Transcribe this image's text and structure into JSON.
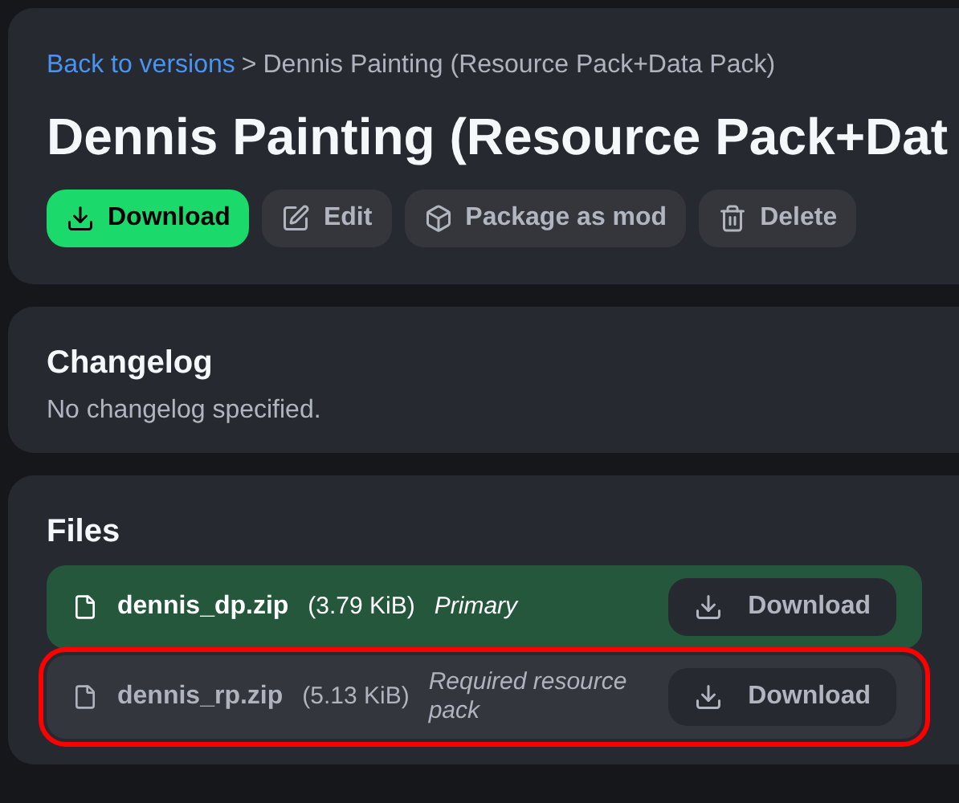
{
  "breadcrumb": {
    "link": "Back to versions",
    "separator": ">",
    "current": "Dennis Painting (Resource Pack+Data Pack)"
  },
  "title": "Dennis Painting (Resource Pack+Dat",
  "actions": [
    {
      "label": "Download",
      "kind": "download",
      "primary": true
    },
    {
      "label": "Edit",
      "kind": "edit",
      "primary": false
    },
    {
      "label": "Package as mod",
      "kind": "package",
      "primary": false
    },
    {
      "label": "Delete",
      "kind": "delete",
      "primary": false
    }
  ],
  "changelog": {
    "heading": "Changelog",
    "text": "No changelog specified."
  },
  "files": {
    "heading": "Files",
    "items": [
      {
        "name": "dennis_dp.zip",
        "size": "(3.79 KiB)",
        "tag": "Primary",
        "primary": true,
        "highlighted": false,
        "button": "Download"
      },
      {
        "name": "dennis_rp.zip",
        "size": "(5.13 KiB)",
        "tag": "Required resource pack",
        "primary": false,
        "highlighted": true,
        "button": "Download"
      }
    ]
  }
}
